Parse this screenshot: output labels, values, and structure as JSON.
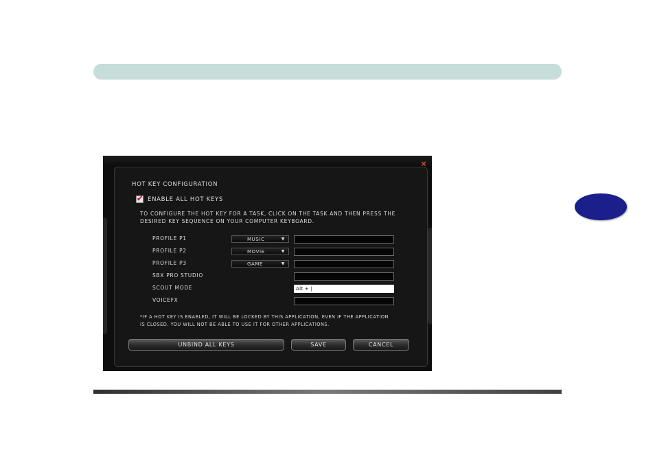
{
  "dialog": {
    "title": "Hot Key Configuration",
    "enable_all_label": "Enable All Hot Keys",
    "enable_all_checked": true,
    "instructions": [
      "To configure the hot key for a task, click on the task and then press the",
      "desired key sequence on your computer keyboard."
    ],
    "rows": [
      {
        "label": "Profile P1",
        "dropdown": "Music",
        "hotkey": ""
      },
      {
        "label": "Profile P2",
        "dropdown": "Movie",
        "hotkey": ""
      },
      {
        "label": "Profile P3",
        "dropdown": "Game",
        "hotkey": ""
      },
      {
        "label": "SBX Pro Studio",
        "hotkey": ""
      },
      {
        "label": "Scout Mode",
        "hotkey": "Alt + |"
      },
      {
        "label": "VoiceFX",
        "hotkey": ""
      }
    ],
    "footnote": [
      "*If a hot key is enabled, it will be locked by this application, even if the application",
      "is closed. You will not be able to use it for other applications."
    ],
    "buttons": {
      "unbind": "Unbind All Keys",
      "save": "Save",
      "cancel": "Cancel"
    },
    "close_symbol": "×"
  },
  "icons": {
    "close": "close-icon",
    "checkbox": "checkmark-icon",
    "dropdown": "chevron-down-icon"
  },
  "colors": {
    "header_bar": "#c6ddd9",
    "chapter_tab": "#1a1f8c",
    "close_icon": "#e0501e",
    "checkmark": "#d4202a"
  }
}
